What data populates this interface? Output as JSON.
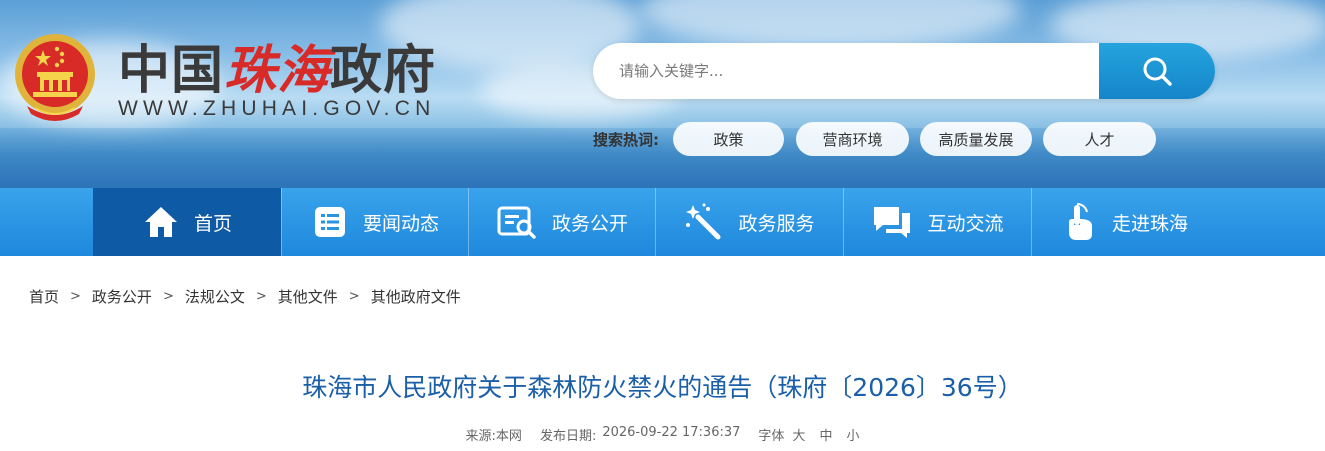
{
  "header": {
    "logo_prefix": "中国",
    "logo_city": "珠海",
    "logo_suffix": "政府",
    "logo_en": "WWW.ZHUHAI.GOV.CN"
  },
  "search": {
    "placeholder": "请输入关键字...",
    "hot_label": "搜索热词:",
    "hot_words": [
      "政策",
      "营商环境",
      "高质量发展",
      "人才"
    ]
  },
  "nav": {
    "items": [
      {
        "label": "首页",
        "icon": "home-icon",
        "active": true
      },
      {
        "label": "要闻动态",
        "icon": "news-list-icon",
        "active": false
      },
      {
        "label": "政务公开",
        "icon": "document-search-icon",
        "active": false
      },
      {
        "label": "政务服务",
        "icon": "magic-wand-icon",
        "active": false
      },
      {
        "label": "互动交流",
        "icon": "chat-bubbles-icon",
        "active": false
      },
      {
        "label": "走进珠海",
        "icon": "pointer-hand-icon",
        "active": false
      }
    ]
  },
  "breadcrumb": [
    "首页",
    "政务公开",
    "法规公文",
    "其他文件",
    "其他政府文件"
  ],
  "article": {
    "title": "珠海市人民政府关于森林防火禁火的通告（珠府〔2026〕36号）",
    "source_label": "来源:",
    "source": "本网",
    "date_label": "发布日期:",
    "date": "2026-09-22 17:36:37",
    "font_label": "字体",
    "font_sizes": [
      "大",
      "中",
      "小"
    ]
  },
  "colors": {
    "nav_blue": "#2a94e4",
    "nav_active": "#0f5aa5",
    "search_button": "#1d96d8",
    "title_blue": "#1a5fa8",
    "logo_red": "#d82b27"
  }
}
